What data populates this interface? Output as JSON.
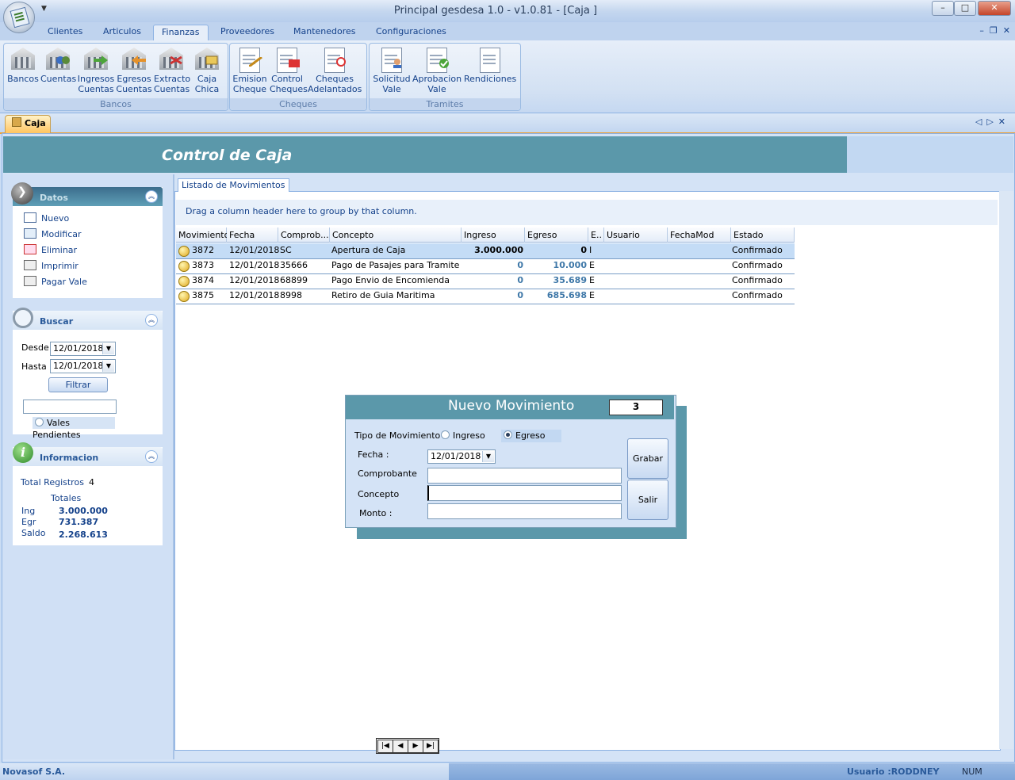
{
  "window": {
    "title": "Principal gesdesa 1.0 - v1.0.81 - [Caja ]",
    "min": "–",
    "max": "□",
    "close": "✕"
  },
  "ribbon": {
    "tabs": [
      "Clientes",
      "Articulos",
      "Finanzas",
      "Proveedores",
      "Mantenedores",
      "Configuraciones"
    ],
    "active_tab": "Finanzas",
    "groups": [
      {
        "caption": "Bancos",
        "buttons": [
          {
            "label": "Bancos",
            "icon": "bank-icon"
          },
          {
            "label": "Cuentas",
            "icon": "accounts-icon"
          },
          {
            "label": "Ingresos\nCuentas",
            "icon": "income-icon"
          },
          {
            "label": "Egresos\nCuentas",
            "icon": "expense-icon"
          },
          {
            "label": "Extracto\nCuentas",
            "icon": "statement-icon"
          },
          {
            "label": "Caja\nChica",
            "icon": "petty-cash-icon"
          }
        ]
      },
      {
        "caption": "Cheques",
        "buttons": [
          {
            "label": "Emision\nCheque",
            "icon": "check-issue-icon"
          },
          {
            "label": "Control\nCheques",
            "icon": "check-control-icon"
          },
          {
            "label": "Cheques\nAdelantados",
            "icon": "check-advance-icon"
          }
        ]
      },
      {
        "caption": "Tramites",
        "buttons": [
          {
            "label": "Solicitud\nVale",
            "icon": "voucher-request-icon"
          },
          {
            "label": "Aprobacion\nVale",
            "icon": "voucher-approve-icon"
          },
          {
            "label": "Rendiciones",
            "icon": "report-icon"
          }
        ]
      }
    ]
  },
  "doc_tab": {
    "label": "Caja"
  },
  "header": {
    "title": "Control de Caja"
  },
  "side": {
    "datos": {
      "title": "Datos",
      "items": [
        {
          "label": "Nuevo",
          "icon": "folder-icon"
        },
        {
          "label": "Modificar",
          "icon": "edit-icon"
        },
        {
          "label": "Eliminar",
          "icon": "delete-icon"
        },
        {
          "label": "Imprimir",
          "icon": "printer-icon"
        },
        {
          "label": "Pagar Vale",
          "icon": "printer-icon"
        }
      ]
    },
    "buscar": {
      "title": "Buscar",
      "desde_label": "Desde",
      "desde_value": "12/01/2018",
      "hasta_label": "Hasta",
      "hasta_value": "12/01/2018",
      "filter_button": "Filtrar",
      "search_value": "",
      "vales_pendientes": "Vales Pendientes"
    },
    "info": {
      "title": "Informacion",
      "total_label": "Total Registros",
      "total_value": "4",
      "totales_label": "Totales",
      "ing_label": "Ing",
      "ing_value": "3.000.000",
      "egr_label": "Egr",
      "egr_value": "731.387",
      "saldo_label": "Saldo",
      "saldo_value": "2.268.613"
    }
  },
  "listing": {
    "tab_label": "Listado de Movimientos",
    "group_hint": "Drag a column header here to group by that column.",
    "columns": [
      "Movimiento",
      "Fecha",
      "Comprob...",
      "Concepto",
      "Ingreso",
      "Egreso",
      "E..",
      "Usuario",
      "FechaMod",
      "Estado"
    ],
    "rows": [
      {
        "movimiento": "3872",
        "fecha": "12/01/2018",
        "comprobante": "SC",
        "concepto": "Apertura de Caja",
        "ingreso": "3.000.000",
        "egreso": "0",
        "e": "I",
        "usuario": "",
        "fechamod": "",
        "estado": "Confirmado"
      },
      {
        "movimiento": "3873",
        "fecha": "12/01/2018",
        "comprobante": "35666",
        "concepto": "Pago de Pasajes para Tramite",
        "ingreso": "0",
        "egreso": "10.000",
        "e": "E",
        "usuario": "",
        "fechamod": "",
        "estado": "Confirmado"
      },
      {
        "movimiento": "3874",
        "fecha": "12/01/2018",
        "comprobante": "68899",
        "concepto": "Pago Envio de Encomienda",
        "ingreso": "0",
        "egreso": "35.689",
        "e": "E",
        "usuario": "",
        "fechamod": "",
        "estado": "Confirmado"
      },
      {
        "movimiento": "3875",
        "fecha": "12/01/2018",
        "comprobante": "8998",
        "concepto": "Retiro de Guia Maritima",
        "ingreso": "0",
        "egreso": "685.698",
        "e": "E",
        "usuario": "",
        "fechamod": "",
        "estado": "Confirmado"
      }
    ],
    "selected_row": 0
  },
  "dialog": {
    "title": "Nuevo Movimiento",
    "number": "3",
    "tipo_label": "Tipo de Movimiento :",
    "ingreso_option": "Ingreso",
    "egreso_option": "Egreso",
    "selected_tipo": "Egreso",
    "fecha_label": "Fecha :",
    "fecha_value": "12/01/2018",
    "comprobante_label": "Comprobante",
    "comprobante_value": "",
    "concepto_label": "Concepto",
    "concepto_value": "",
    "monto_label": "Monto :",
    "monto_value": "",
    "grabar_button": "Grabar",
    "salir_button": "Salir"
  },
  "status": {
    "company": "Novasof S.A.",
    "user": "Usuario :RODDNEY",
    "num": "NUM"
  },
  "colors": {
    "accent": "#5b98aa",
    "ribbon_text": "#15428b",
    "selected_row": "#c4dcf6"
  }
}
